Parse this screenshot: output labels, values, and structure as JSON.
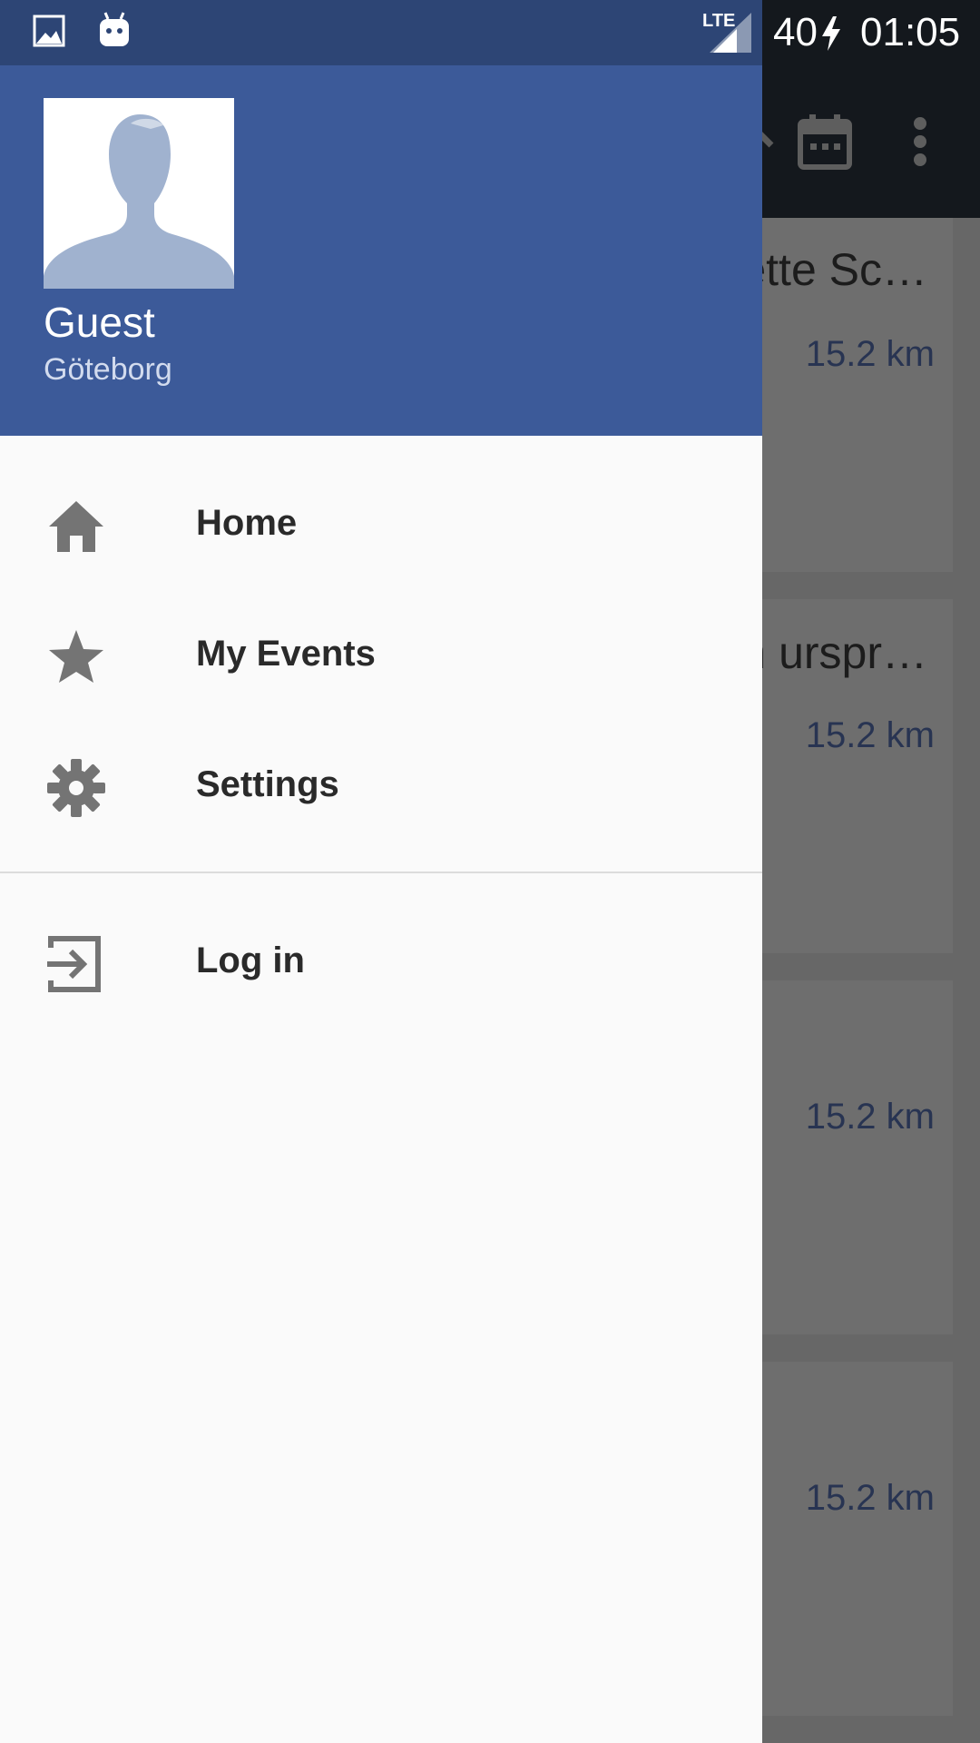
{
  "status_bar": {
    "network": "LTE",
    "battery": "40",
    "time": "01:05"
  },
  "drawer": {
    "user": {
      "name": "Guest",
      "city": "Göteborg"
    },
    "menu": [
      {
        "label": "Home",
        "icon": "home-icon"
      },
      {
        "label": "My Events",
        "icon": "star-icon"
      },
      {
        "label": "Settings",
        "icon": "gear-icon"
      }
    ],
    "secondary_menu": [
      {
        "label": "Log in",
        "icon": "login-icon"
      }
    ]
  },
  "background_list": {
    "items": [
      {
        "title": "ette Sc…",
        "distance": "15.2 km"
      },
      {
        "title": "n urspr…",
        "distance": "15.2 km"
      },
      {
        "title": "",
        "distance": "15.2 km"
      },
      {
        "title": "",
        "distance": "15.2 km"
      }
    ]
  },
  "colors": {
    "header": "#3c5a99",
    "status_bar": "#2d4575",
    "scrim": "#676767"
  }
}
